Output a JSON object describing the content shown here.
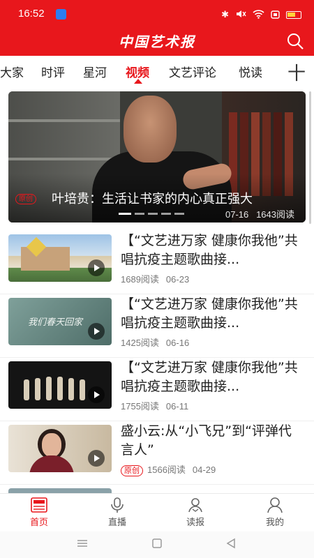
{
  "status_bar": {
    "time": "16:52",
    "colors": {
      "background": "#e8171c"
    },
    "icons": [
      "app-indicator-icon",
      "bluetooth-icon",
      "mute-icon",
      "wifi-icon",
      "sim-icon",
      "battery-icon"
    ]
  },
  "header": {
    "logo_text": "中国艺术报",
    "search_icon": "search-icon",
    "accent": "#e8171c"
  },
  "tabs": {
    "items": [
      {
        "label": "大家"
      },
      {
        "label": "时评"
      },
      {
        "label": "星河"
      },
      {
        "label": "视频",
        "active": true
      },
      {
        "label": "文艺评论"
      },
      {
        "label": "悦读"
      }
    ],
    "add_label": "十"
  },
  "featured": {
    "badge": "原创",
    "title": "叶培贵：生活让书家的内心真正强大",
    "date": "07-16",
    "reads": "1643阅读",
    "slide_count": 5,
    "active_slide": 1
  },
  "list": [
    {
      "title": "【“文艺进万家 健康你我他”共唱抗疫主题歌曲接...",
      "reads": "1689阅读",
      "date": "06-23"
    },
    {
      "title": "【“文艺进万家 健康你我他”共唱抗疫主题歌曲接...",
      "reads": "1425阅读",
      "date": "06-16",
      "thumb_text": "我们春天回家"
    },
    {
      "title": "【“文艺进万家 健康你我他”共唱抗疫主题歌曲接...",
      "reads": "1755阅读",
      "date": "06-11"
    },
    {
      "title": "盛小云:从“小飞兄”到“评弹代言人”",
      "badge": "原创",
      "reads": "1566阅读",
      "date": "04-29"
    }
  ],
  "bottom_nav": {
    "items": [
      {
        "label": "首页",
        "icon": "news-icon",
        "active": true
      },
      {
        "label": "直播",
        "icon": "microphone-icon"
      },
      {
        "label": "读报",
        "icon": "reader-icon"
      },
      {
        "label": "我的",
        "icon": "person-icon"
      }
    ]
  },
  "system_nav": {
    "icons": [
      "menu-icon",
      "home-icon",
      "back-icon"
    ]
  }
}
